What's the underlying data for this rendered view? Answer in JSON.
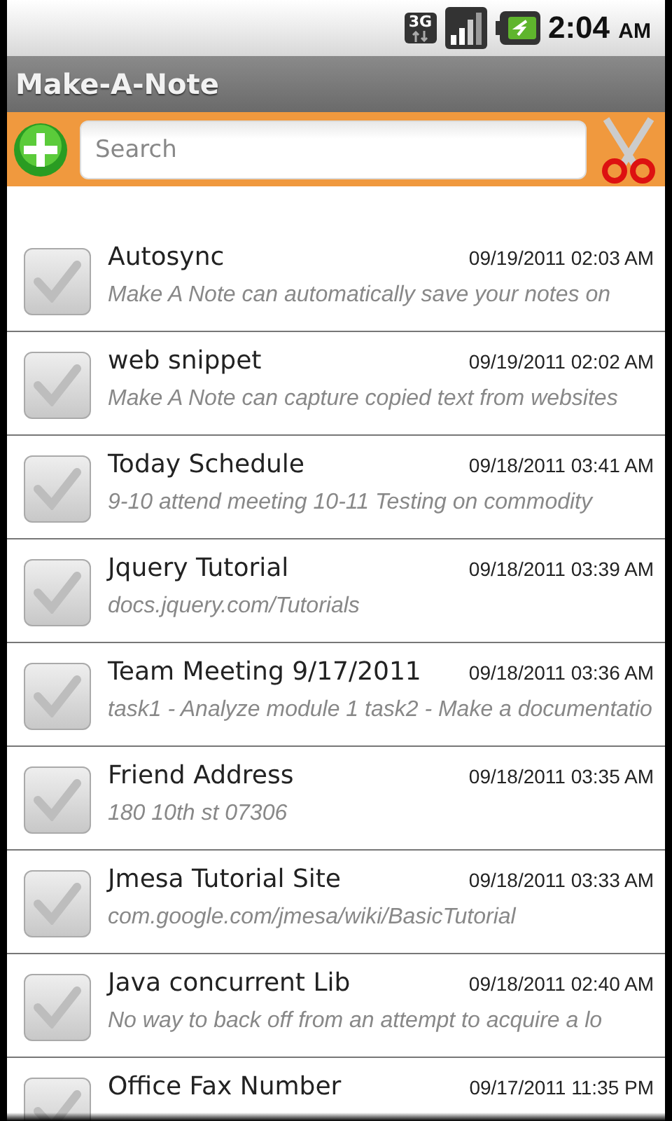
{
  "status_bar": {
    "time": "2:04",
    "time_suffix": "AM",
    "network": "3G"
  },
  "app_bar": {
    "title": "Make-A-Note"
  },
  "toolbar": {
    "search": {
      "placeholder": "Search"
    }
  },
  "notes": [
    {
      "title": "Autosync",
      "date": "09/19/2011 02:03 AM",
      "snippet": "Make A Note can automatically save your notes on",
      "checked": false
    },
    {
      "title": "web snippet",
      "date": "09/19/2011 02:02 AM",
      "snippet": "Make A Note can capture copied text from websites",
      "checked": false
    },
    {
      "title": "Today Schedule",
      "date": "09/18/2011 03:41 AM",
      "snippet": "9-10 attend meeting 10-11 Testing on commodity",
      "checked": false
    },
    {
      "title": "Jquery Tutorial",
      "date": "09/18/2011 03:39 AM",
      "snippet": "docs.jquery.com/Tutorials",
      "checked": false
    },
    {
      "title": "Team Meeting 9/17/2011",
      "date": "09/18/2011 03:36 AM",
      "snippet": "task1 - Analyze module 1 task2 - Make a documentatio",
      "checked": false
    },
    {
      "title": "Friend Address",
      "date": "09/18/2011 03:35 AM",
      "snippet": "180 10th st 07306",
      "checked": false
    },
    {
      "title": "Jmesa Tutorial Site",
      "date": "09/18/2011 03:33 AM",
      "snippet": "com.google.com/jmesa/wiki/BasicTutorial",
      "checked": false
    },
    {
      "title": "Java concurrent Lib",
      "date": "09/18/2011 02:40 AM",
      "snippet": "No way to back off from an attempt to acquire a lo",
      "checked": false
    },
    {
      "title": "Office Fax Number",
      "date": "09/17/2011 11:35 PM",
      "checked": false
    }
  ]
}
